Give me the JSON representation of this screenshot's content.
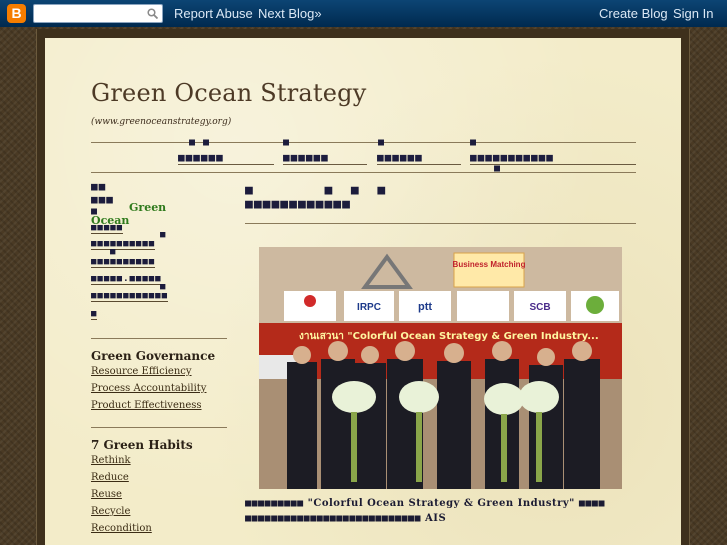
{
  "navbar": {
    "logo_letter": "B",
    "search_placeholder": "",
    "report_abuse": "Report Abuse",
    "next_blog": "Next Blog»",
    "create_blog": "Create Blog",
    "sign_in": "Sign In"
  },
  "header": {
    "title": "Green Ocean Strategy",
    "description": "(www.greenoceanstrategy.org)"
  },
  "menu": {
    "items": [
      "■■■■■■",
      "■■■■■■",
      "■■■■■■",
      "■■■■■■■■■■■"
    ]
  },
  "sidebar": {
    "green_label": "Green",
    "ocean_label": "Ocean",
    "governance": {
      "heading": "Green Governance",
      "links": [
        "Resource Efficiency",
        "Process Accountability",
        "Product Effectiveness"
      ]
    },
    "habits": {
      "heading": "7 Green Habits",
      "links": [
        "Rethink",
        "Reduce",
        "Reuse",
        "Recycle",
        "Recondition"
      ]
    }
  },
  "post": {
    "photo_banner_text": "งานเสวนา \"Colorful Ocean Strategy & Green Industry...",
    "business_matching": "Business Matching",
    "caption_quote": "\"Colorful Ocean Strategy & Green Industry\"",
    "caption_tail": "AIS"
  },
  "colors": {
    "navbar": "#00345e",
    "paper": "#f3ecc9",
    "title": "#4d3a26",
    "green": "#2f7a1c"
  }
}
